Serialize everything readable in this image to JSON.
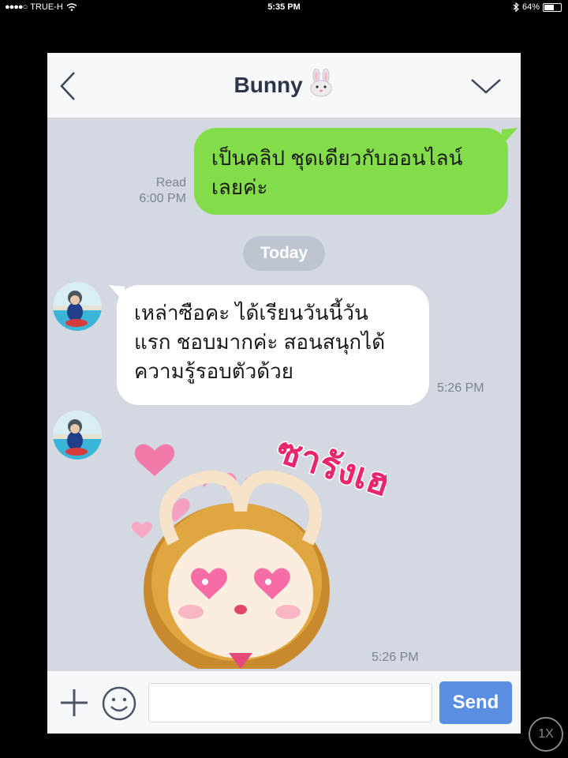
{
  "status_bar": {
    "carrier": "TRUE-H",
    "time": "5:35 PM",
    "battery": "64%",
    "battery_level": 0.64
  },
  "chat": {
    "title": "Bunny",
    "title_emoji": "rabbit-face",
    "messages": [
      {
        "direction": "out",
        "text_line1": "เป็นคลิป ชุดเดียวกับออนไลน์",
        "text_line2": "เลยค่ะ",
        "status": "Read",
        "time": "6:00 PM"
      },
      {
        "direction": "in",
        "text_line1": "เหล่าซือคะ ได้เรียนวันนี้วัน",
        "text_line2": "แรก ชอบมากค่ะ สอนสนุกได้",
        "text_line3": "ความรู้รอบตัวด้วย",
        "time": "5:26 PM"
      },
      {
        "direction": "in",
        "type": "sticker",
        "sticker_text": "ซารังเฮ",
        "time": "5:26 PM"
      }
    ],
    "date_separator": "Today"
  },
  "input_bar": {
    "placeholder": "",
    "send_label": "Send"
  },
  "zoom_label": "1X",
  "colors": {
    "outgoing_bubble": "#83dc4a",
    "incoming_bubble": "#ffffff",
    "chat_background": "#d4d8e0",
    "send_button": "#5a8ee0"
  }
}
